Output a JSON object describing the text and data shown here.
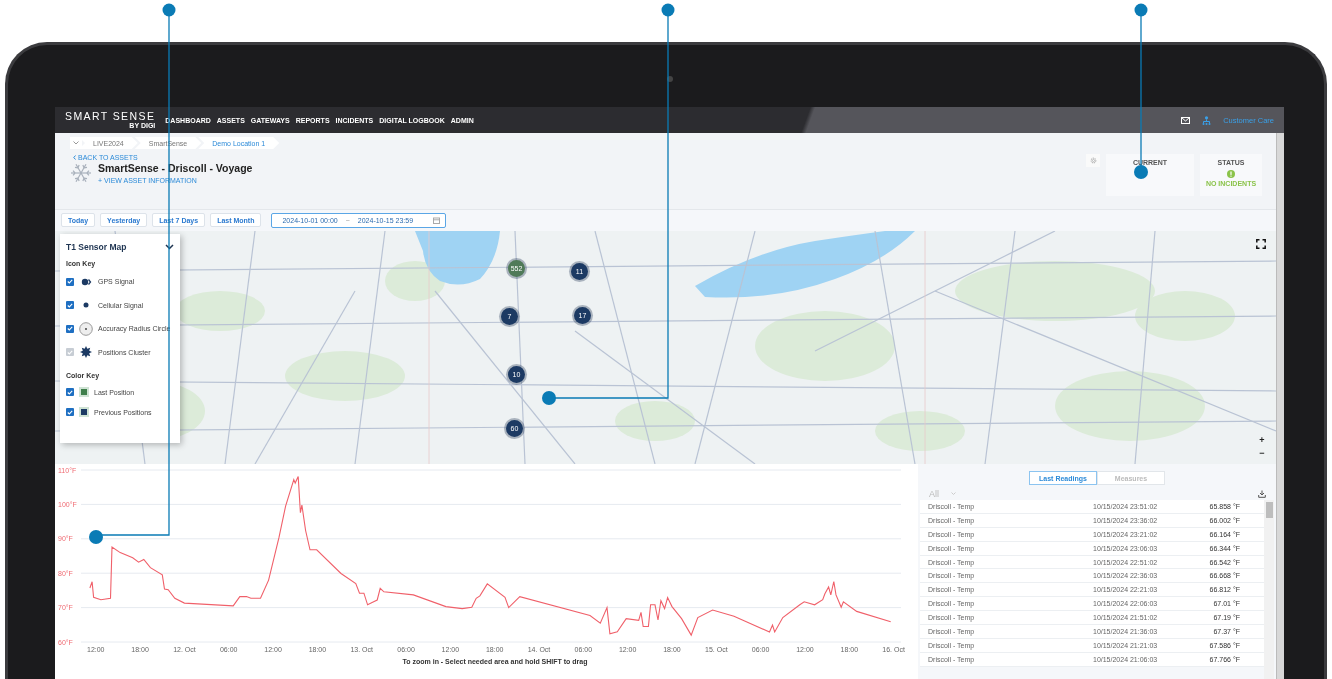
{
  "navbar": {
    "logo": "SMART SENSE",
    "logo_sub": "BY DIGI",
    "links": [
      "DASHBOARD",
      "ASSETS",
      "GATEWAYS",
      "REPORTS",
      "INCIDENTS",
      "DIGITAL LOGBOOK",
      "ADMIN"
    ],
    "user": "Customer Care"
  },
  "breadcrumbs": [
    {
      "label": "LIVE2024",
      "selected": false
    },
    {
      "label": "SmartSense",
      "selected": false
    },
    {
      "label": "Demo Location 1",
      "selected": true
    }
  ],
  "asset": {
    "back": "BACK TO ASSETS",
    "title": "SmartSense - Driscoll - Voyage",
    "info_link": "+ VIEW ASSET INFORMATION"
  },
  "cards": [
    {
      "kind": "current",
      "label": "CURRENT"
    },
    {
      "kind": "status",
      "label": "STATUS",
      "value": "NO INCIDENTS"
    }
  ],
  "quick_ranges": [
    "Today",
    "Yesterday",
    "Last 7 Days",
    "Last Month"
  ],
  "date_range": {
    "start": "2024-10-01 00:00",
    "separator": "~",
    "end": "2024-10-15 23:59"
  },
  "map": {
    "panel": {
      "title": "T1 Sensor Map",
      "icon_key_title": "Icon Key",
      "icon_key": [
        {
          "kind": "gps",
          "label": "GPS Signal",
          "checked": true,
          "disabled": false
        },
        {
          "kind": "cellular",
          "label": "Cellular Signal",
          "checked": true,
          "disabled": false
        },
        {
          "kind": "accuracy",
          "label": "Accuracy Radius Circle",
          "checked": true,
          "disabled": false
        },
        {
          "kind": "cluster",
          "label": "Positions Cluster",
          "checked": true,
          "disabled": true
        }
      ],
      "color_key_title": "Color Key",
      "color_key": [
        {
          "label": "Last Position",
          "checked": true,
          "color": "#3f7f4c"
        },
        {
          "label": "Previous Positions",
          "checked": true,
          "color": "#1c3a63"
        }
      ]
    },
    "clusters": [
      {
        "label": "552",
        "color": "#4f7a58"
      },
      {
        "label": "11",
        "color": "#1c3a63"
      },
      {
        "label": "7",
        "color": "#1c3a63"
      },
      {
        "label": "17",
        "color": "#1c3a63"
      },
      {
        "label": "10",
        "color": "#1c3a63"
      },
      {
        "label": "60",
        "color": "#1c3a63"
      }
    ],
    "zoom_controls": [
      "+",
      "−"
    ]
  },
  "chart": {
    "hint": "To zoom in - Select needed area and hold SHIFT to drag",
    "chart_data": {
      "type": "line",
      "grid": true,
      "xlim": [
        "2024-10-11T10:00",
        "2024-10-16T01:00"
      ],
      "ylim": [
        60,
        110
      ],
      "yticks": [
        {
          "value": 60,
          "label": "60°F"
        },
        {
          "value": 70,
          "label": "70°F"
        },
        {
          "value": 80,
          "label": "80°F"
        },
        {
          "value": 90,
          "label": "90°F"
        },
        {
          "value": 100,
          "label": "100°F"
        },
        {
          "value": 110,
          "label": "110°F"
        }
      ],
      "xticks": [
        {
          "value": "2024-10-11T12:00",
          "label": "12:00"
        },
        {
          "value": "2024-10-11T18:00",
          "label": "18:00"
        },
        {
          "value": "2024-10-12T00:00",
          "label": "12. Oct"
        },
        {
          "value": "2024-10-12T06:00",
          "label": "06:00"
        },
        {
          "value": "2024-10-12T12:00",
          "label": "12:00"
        },
        {
          "value": "2024-10-12T18:00",
          "label": "18:00"
        },
        {
          "value": "2024-10-13T00:00",
          "label": "13. Oct"
        },
        {
          "value": "2024-10-13T06:00",
          "label": "06:00"
        },
        {
          "value": "2024-10-13T12:00",
          "label": "12:00"
        },
        {
          "value": "2024-10-13T18:00",
          "label": "18:00"
        },
        {
          "value": "2024-10-14T00:00",
          "label": "14. Oct"
        },
        {
          "value": "2024-10-14T06:00",
          "label": "06:00"
        },
        {
          "value": "2024-10-14T12:00",
          "label": "12:00"
        },
        {
          "value": "2024-10-14T18:00",
          "label": "18:00"
        },
        {
          "value": "2024-10-15T00:00",
          "label": "15. Oct"
        },
        {
          "value": "2024-10-15T06:00",
          "label": "06:00"
        },
        {
          "value": "2024-10-15T12:00",
          "label": "12:00"
        },
        {
          "value": "2024-10-15T18:00",
          "label": "18:00"
        },
        {
          "value": "2024-10-16T00:00",
          "label": "16. Oct"
        }
      ],
      "x": [
        "2024-10-11T11:12",
        "2024-10-11T11:30",
        "2024-10-11T11:42",
        "2024-10-11T12:42",
        "2024-10-11T14:00",
        "2024-10-11T14:12",
        "2024-10-11T15:18",
        "2024-10-11T17:00",
        "2024-10-11T17:48",
        "2024-10-11T18:30",
        "2024-10-11T19:24",
        "2024-10-11T21:00",
        "2024-10-11T21:18",
        "2024-10-11T21:48",
        "2024-10-11T22:42",
        "2024-10-12T00:00",
        "2024-10-12T06:36",
        "2024-10-12T07:30",
        "2024-10-12T08:24",
        "2024-10-12T09:00",
        "2024-10-12T10:18",
        "2024-10-12T11:24",
        "2024-10-12T12:48",
        "2024-10-12T13:42",
        "2024-10-12T14:48",
        "2024-10-12T15:00",
        "2024-10-12T15:24",
        "2024-10-12T15:42",
        "2024-10-12T15:54",
        "2024-10-12T16:24",
        "2024-10-12T17:00",
        "2024-10-12T17:54",
        "2024-10-12T21:12",
        "2024-10-12T23:12",
        "2024-10-12T23:42",
        "2024-10-13T00:18",
        "2024-10-13T00:48",
        "2024-10-13T01:24",
        "2024-10-13T02:06",
        "2024-10-13T02:30",
        "2024-10-13T03:00",
        "2024-10-13T07:00",
        "2024-10-13T11:24",
        "2024-10-13T13:36",
        "2024-10-13T14:54",
        "2024-10-13T15:30",
        "2024-10-13T16:00",
        "2024-10-13T17:00",
        "2024-10-13T19:24",
        "2024-10-13T19:54",
        "2024-10-13T21:24",
        "2024-10-14T06:54",
        "2024-10-14T08:18",
        "2024-10-14T09:12",
        "2024-10-14T09:36",
        "2024-10-14T10:36",
        "2024-10-14T11:48",
        "2024-10-14T13:30",
        "2024-10-14T13:48",
        "2024-10-14T14:06",
        "2024-10-14T14:48",
        "2024-10-14T15:06",
        "2024-10-14T15:42",
        "2024-10-14T16:06",
        "2024-10-14T16:30",
        "2024-10-14T17:00",
        "2024-10-14T17:24",
        "2024-10-14T18:00",
        "2024-10-14T19:18",
        "2024-10-14T20:36",
        "2024-10-14T21:30",
        "2024-10-14T23:30",
        "2024-10-15T02:24",
        "2024-10-15T07:12",
        "2024-10-15T07:36",
        "2024-10-15T07:54",
        "2024-10-15T09:00",
        "2024-10-15T11:18",
        "2024-10-15T11:54",
        "2024-10-15T13:18",
        "2024-10-15T14:24",
        "2024-10-15T14:42",
        "2024-10-15T15:12",
        "2024-10-15T15:30",
        "2024-10-15T15:54",
        "2024-10-15T16:12",
        "2024-10-15T16:54",
        "2024-10-15T17:12",
        "2024-10-15T19:00",
        "2024-10-15T23:36"
      ],
      "series": [
        {
          "color": "#f0606a",
          "values": [
            75.7,
            77.5,
            73,
            72.3,
            72.7,
            87.6,
            86,
            84.5,
            83.2,
            84,
            81.6,
            79.5,
            75.4,
            75.2,
            72.7,
            71.3,
            70.5,
            73.2,
            73.2,
            72.7,
            72.7,
            78,
            90.4,
            99.5,
            107.2,
            106.2,
            108.1,
            97.6,
            99.8,
            92.4,
            86.8,
            86.8,
            79.9,
            77,
            74.2,
            74.2,
            70.8,
            71.5,
            72.2,
            75.6,
            74.6,
            73.7,
            70.3,
            69.7,
            70.1,
            72.7,
            73.4,
            76.9,
            73,
            70,
            73.2,
            67.7,
            65.5,
            70,
            62.4,
            63,
            66.8,
            66.3,
            68.6,
            64.5,
            64.5,
            70.8,
            70.8,
            66.4,
            72,
            69.7,
            72.9,
            70.3,
            66.8,
            62,
            67.1,
            69.3,
            67.5,
            62.9,
            64.9,
            62.9,
            67.1,
            70.8,
            71.7,
            70.8,
            72.3,
            74,
            76,
            73.7,
            77.6,
            73.7,
            70.1,
            71.7,
            68.9,
            65.9
          ]
        }
      ]
    }
  },
  "readings": {
    "tabs": [
      {
        "label": "Last Readings",
        "selected": true
      },
      {
        "label": "Measures",
        "selected": false
      }
    ],
    "filter": "All",
    "rows": [
      {
        "sensor": "Driscoll - Temp",
        "time": "10/15/2024 23:51:02",
        "value": "65.858 °F"
      },
      {
        "sensor": "Driscoll - Temp",
        "time": "10/15/2024 23:36:02",
        "value": "66.002 °F"
      },
      {
        "sensor": "Driscoll - Temp",
        "time": "10/15/2024 23:21:02",
        "value": "66.164 °F"
      },
      {
        "sensor": "Driscoll - Temp",
        "time": "10/15/2024 23:06:03",
        "value": "66.344 °F"
      },
      {
        "sensor": "Driscoll - Temp",
        "time": "10/15/2024 22:51:02",
        "value": "66.542 °F"
      },
      {
        "sensor": "Driscoll - Temp",
        "time": "10/15/2024 22:36:03",
        "value": "66.668 °F"
      },
      {
        "sensor": "Driscoll - Temp",
        "time": "10/15/2024 22:21:03",
        "value": "66.812 °F"
      },
      {
        "sensor": "Driscoll - Temp",
        "time": "10/15/2024 22:06:03",
        "value": "67.01 °F"
      },
      {
        "sensor": "Driscoll - Temp",
        "time": "10/15/2024 21:51:02",
        "value": "67.19 °F"
      },
      {
        "sensor": "Driscoll - Temp",
        "time": "10/15/2024 21:36:03",
        "value": "67.37 °F"
      },
      {
        "sensor": "Driscoll - Temp",
        "time": "10/15/2024 21:21:03",
        "value": "67.586 °F"
      },
      {
        "sensor": "Driscoll - Temp",
        "time": "10/15/2024 21:06:03",
        "value": "67.766 °F"
      }
    ]
  }
}
